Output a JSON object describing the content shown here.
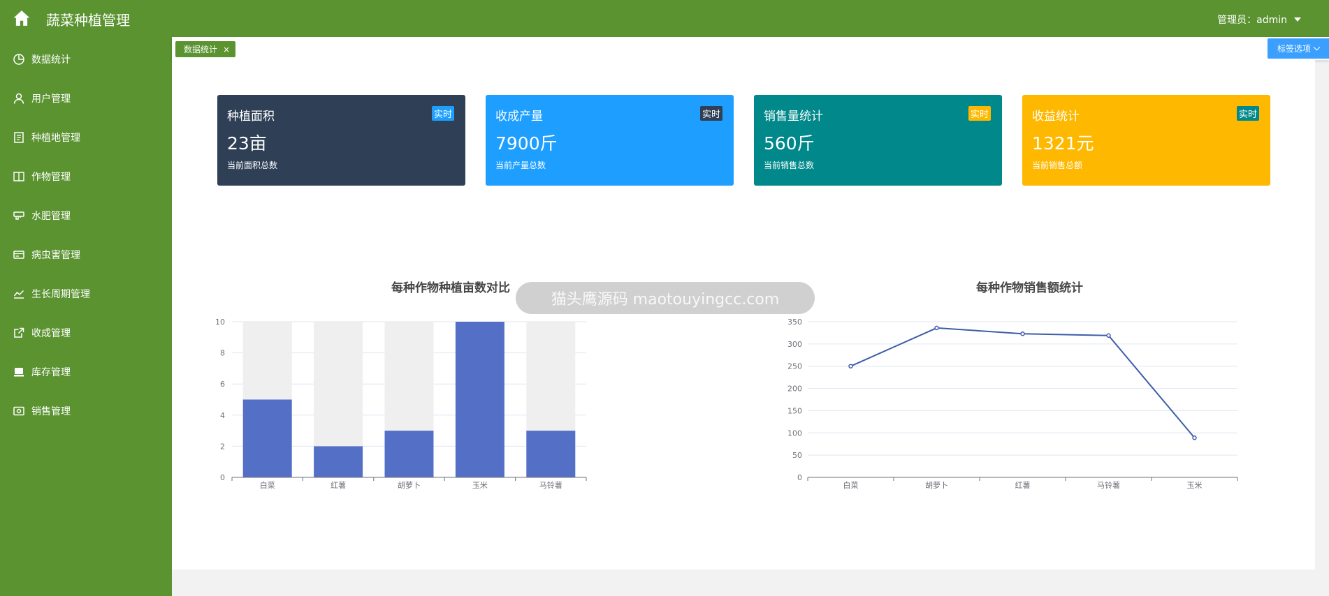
{
  "header": {
    "title": "蔬菜种植管理",
    "admin_label": "管理员：admin"
  },
  "sidebar": {
    "items": [
      {
        "label": "数据统计",
        "icon": "pie-chart-icon"
      },
      {
        "label": "用户管理",
        "icon": "user-icon"
      },
      {
        "label": "种植地管理",
        "icon": "document-icon"
      },
      {
        "label": "作物管理",
        "icon": "book-icon"
      },
      {
        "label": "水肥管理",
        "icon": "tap-icon"
      },
      {
        "label": "病虫害管理",
        "icon": "card-icon"
      },
      {
        "label": "生长周期管理",
        "icon": "line-chart-icon"
      },
      {
        "label": "收成管理",
        "icon": "export-icon"
      },
      {
        "label": "库存管理",
        "icon": "inbox-icon"
      },
      {
        "label": "销售管理",
        "icon": "cash-icon"
      }
    ]
  },
  "tabs": {
    "active": "数据统计",
    "close_glyph": "×",
    "options_label": "标签选项"
  },
  "cards": [
    {
      "title": "种植面积",
      "badge": "实时",
      "value": "23亩",
      "desc": "当前面积总数",
      "color": "#2f4056",
      "badge_bg": "#1e9fff"
    },
    {
      "title": "收成产量",
      "badge": "实时",
      "value": "7900斤",
      "desc": "当前产量总数",
      "color": "#1e9fff",
      "badge_bg": "#2f4056"
    },
    {
      "title": "销售量统计",
      "badge": "实时",
      "value": "560斤",
      "desc": "当前销售总数",
      "color": "#00888a",
      "badge_bg": "#ffb800"
    },
    {
      "title": "收益统计",
      "badge": "实时",
      "value": "1321元",
      "desc": "当前销售总额",
      "color": "#ffb800",
      "badge_bg": "#00888a"
    }
  ],
  "chart_data": [
    {
      "type": "bar",
      "title": "每种作物种植亩数对比",
      "categories": [
        "白菜",
        "红薯",
        "胡萝卜",
        "玉米",
        "马铃薯"
      ],
      "values": [
        5,
        2,
        3,
        10,
        3
      ],
      "ylim": [
        0,
        10
      ],
      "yticks": [
        0,
        2,
        4,
        6,
        8,
        10
      ],
      "bar_color": "#5470c6",
      "background_bars": true,
      "grid": true
    },
    {
      "type": "line",
      "title": "每种作物销售额统计",
      "categories": [
        "白菜",
        "胡萝卜",
        "红薯",
        "马铃薯",
        "玉米"
      ],
      "values": [
        250,
        336,
        323,
        319,
        89
      ],
      "ylim": [
        0,
        350
      ],
      "yticks": [
        0,
        50,
        100,
        150,
        200,
        250,
        300,
        350
      ],
      "line_color": "#3e5da8",
      "grid": true
    }
  ],
  "overlay": {
    "watermark_text": "猫头鹰源码 maotouyingcc.com"
  }
}
